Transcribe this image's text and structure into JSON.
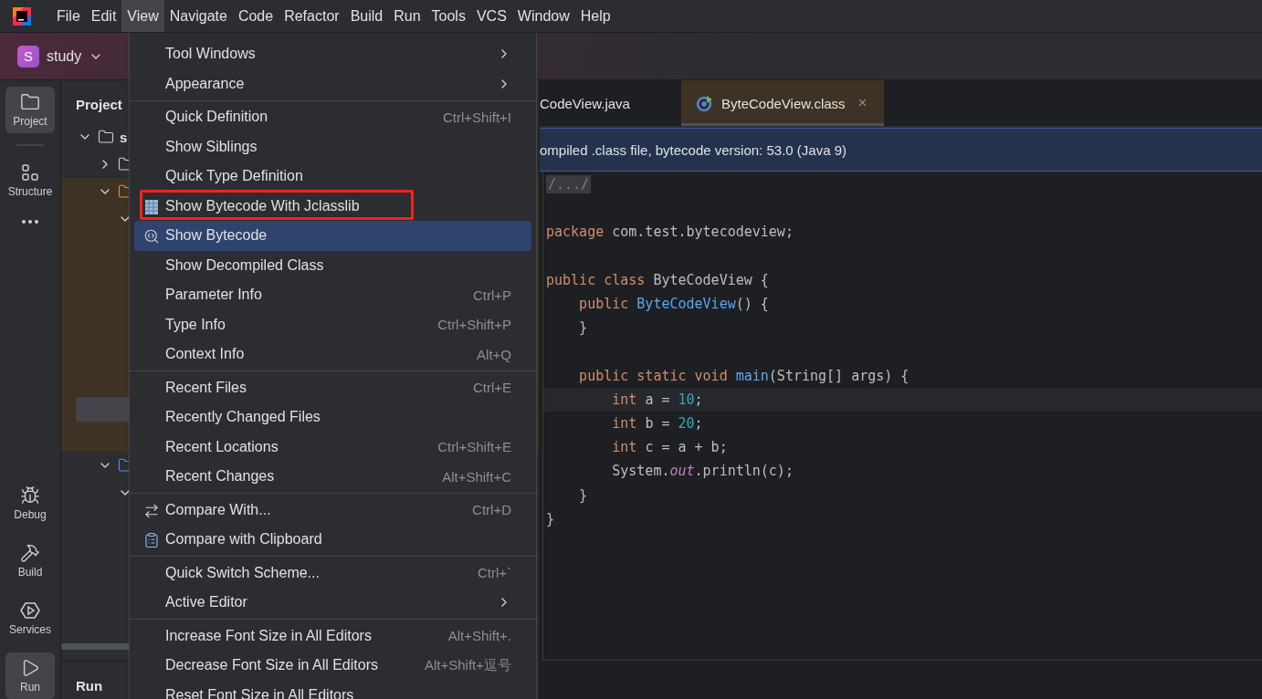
{
  "menu_bar": [
    {
      "label": "File",
      "selected": false
    },
    {
      "label": "Edit",
      "selected": false
    },
    {
      "label": "View",
      "selected": true
    },
    {
      "label": "Navigate",
      "selected": false
    },
    {
      "label": "Code",
      "selected": false
    },
    {
      "label": "Refactor",
      "selected": false
    },
    {
      "label": "Build",
      "selected": false
    },
    {
      "label": "Run",
      "selected": false
    },
    {
      "label": "Tools",
      "selected": false
    },
    {
      "label": "VCS",
      "selected": false
    },
    {
      "label": "Window",
      "selected": false
    },
    {
      "label": "Help",
      "selected": false
    }
  ],
  "toolbar": {
    "project_avatar": "S",
    "project_name": "study"
  },
  "tool_strip": {
    "top": [
      {
        "kind": "folder",
        "label": "Project",
        "selected": true
      },
      {
        "kind": "structure",
        "label": "Structure",
        "selected": false
      },
      {
        "kind": "more",
        "selected": false
      }
    ],
    "bottom": [
      {
        "kind": "debug",
        "label": "Debug",
        "selected": false
      },
      {
        "kind": "build",
        "label": "Build",
        "selected": false
      },
      {
        "kind": "services",
        "label": "Services",
        "selected": false
      },
      {
        "kind": "run",
        "label": "Run",
        "selected": true
      }
    ]
  },
  "project_panel": {
    "title": "Project",
    "tree": [
      {
        "label": "s",
        "expanded": true,
        "children": [
          {
            "expanded": false,
            "kind": "plain"
          },
          {
            "expanded": true,
            "kind": "source",
            "highlighted": true,
            "children": [
              {
                "expanded": true
              }
            ]
          },
          {
            "expanded": true,
            "kind": "module",
            "children": [
              {
                "expanded": true
              }
            ]
          }
        ]
      }
    ],
    "bottom_title": "Run"
  },
  "view_menu": [
    [
      {
        "kind": "submenu",
        "label": "Tool Windows"
      },
      {
        "kind": "submenu",
        "label": "Appearance"
      }
    ],
    [
      {
        "kind": "plain",
        "label": "Quick Definition",
        "shortcut": "Ctrl+Shift+I",
        "selected": false,
        "outlined": false
      },
      {
        "kind": "plain",
        "label": "Show Siblings",
        "selected": false,
        "outlined": false
      },
      {
        "kind": "plain",
        "label": "Quick Type Definition",
        "selected": false,
        "outlined": false
      },
      {
        "kind": "jclasslib",
        "label": "Show Bytecode With Jclasslib",
        "selected": false,
        "outlined": true
      },
      {
        "kind": "bytecode",
        "label": "Show Bytecode",
        "selected": true,
        "outlined": false
      },
      {
        "kind": "plain",
        "label": "Show Decompiled Class",
        "selected": false,
        "outlined": false
      },
      {
        "kind": "plain",
        "label": "Parameter Info",
        "shortcut": "Ctrl+P",
        "selected": false,
        "outlined": false
      },
      {
        "kind": "plain",
        "label": "Type Info",
        "shortcut": "Ctrl+Shift+P",
        "selected": false,
        "outlined": false
      },
      {
        "kind": "plain",
        "label": "Context Info",
        "shortcut": "Alt+Q",
        "selected": false,
        "outlined": false
      }
    ],
    [
      {
        "kind": "plain",
        "label": "Recent Files",
        "shortcut": "Ctrl+E"
      },
      {
        "kind": "plain",
        "label": "Recently Changed Files"
      },
      {
        "kind": "plain",
        "label": "Recent Locations",
        "shortcut": "Ctrl+Shift+E"
      },
      {
        "kind": "plain",
        "label": "Recent Changes",
        "shortcut": "Alt+Shift+C"
      }
    ],
    [
      {
        "kind": "compare",
        "label": "Compare With...",
        "shortcut": "Ctrl+D"
      },
      {
        "kind": "clipboard",
        "label": "Compare with Clipboard"
      }
    ],
    [
      {
        "kind": "plain",
        "label": "Quick Switch Scheme...",
        "shortcut": "Ctrl+`"
      },
      {
        "kind": "submenu",
        "label": "Active Editor"
      }
    ],
    [
      {
        "kind": "plain",
        "label": "Increase Font Size in All Editors",
        "shortcut": "Alt+Shift+."
      },
      {
        "kind": "plain",
        "label": "Decrease Font Size in All Editors",
        "shortcut": "Alt+Shift+逗号"
      },
      {
        "kind": "plain",
        "label": "Reset Font Size in All Editors"
      }
    ]
  ],
  "editor": {
    "tabs": [
      {
        "label": "CodeView.java",
        "selected": false
      },
      {
        "label": "ByteCodeView.class",
        "selected": true,
        "close": "×"
      }
    ],
    "banner": "ompiled .class file, bytecode version: 53.0 (Java 9)",
    "lines": [
      {
        "current": false,
        "tokens": [
          {
            "kind": "fold",
            "text": "/.../"
          }
        ]
      },
      {
        "current": false
      },
      {
        "current": false,
        "tokens": [
          {
            "kind": "kw",
            "text": "package "
          },
          {
            "kind": "plain",
            "text": "com.test.bytecodeview;"
          }
        ]
      },
      {
        "current": false
      },
      {
        "current": false,
        "tokens": [
          {
            "kind": "kw",
            "text": "public class "
          },
          {
            "kind": "plain",
            "text": "ByteCodeView {"
          }
        ]
      },
      {
        "current": false,
        "tokens": [
          {
            "kind": "kw",
            "text": "    public "
          },
          {
            "kind": "fn",
            "text": "ByteCodeView"
          },
          {
            "kind": "plain",
            "text": "() {"
          }
        ]
      },
      {
        "current": false,
        "tokens": [
          {
            "kind": "plain",
            "text": "    }"
          }
        ]
      },
      {
        "current": false
      },
      {
        "current": false,
        "tokens": [
          {
            "kind": "kw",
            "text": "    public static void "
          },
          {
            "kind": "fn",
            "text": "main"
          },
          {
            "kind": "plain",
            "text": "(String[] args) {"
          }
        ]
      },
      {
        "current": true,
        "tokens": [
          {
            "kind": "kw",
            "text": "        int "
          },
          {
            "kind": "plain",
            "text": "a = "
          },
          {
            "kind": "num",
            "text": "10"
          },
          {
            "kind": "plain",
            "text": ";"
          }
        ]
      },
      {
        "current": false,
        "tokens": [
          {
            "kind": "kw",
            "text": "        int "
          },
          {
            "kind": "plain",
            "text": "b = "
          },
          {
            "kind": "num",
            "text": "20"
          },
          {
            "kind": "plain",
            "text": ";"
          }
        ]
      },
      {
        "current": false,
        "tokens": [
          {
            "kind": "kw",
            "text": "        int "
          },
          {
            "kind": "plain",
            "text": "c = a + b;"
          }
        ]
      },
      {
        "current": false,
        "tokens": [
          {
            "kind": "plain",
            "text": "        System."
          },
          {
            "kind": "field",
            "text": "out"
          },
          {
            "kind": "plain",
            "text": ".println(c);"
          }
        ]
      },
      {
        "current": false,
        "tokens": [
          {
            "kind": "plain",
            "text": "    }"
          }
        ]
      },
      {
        "current": false,
        "tokens": [
          {
            "kind": "plain",
            "text": "}"
          }
        ]
      }
    ]
  }
}
